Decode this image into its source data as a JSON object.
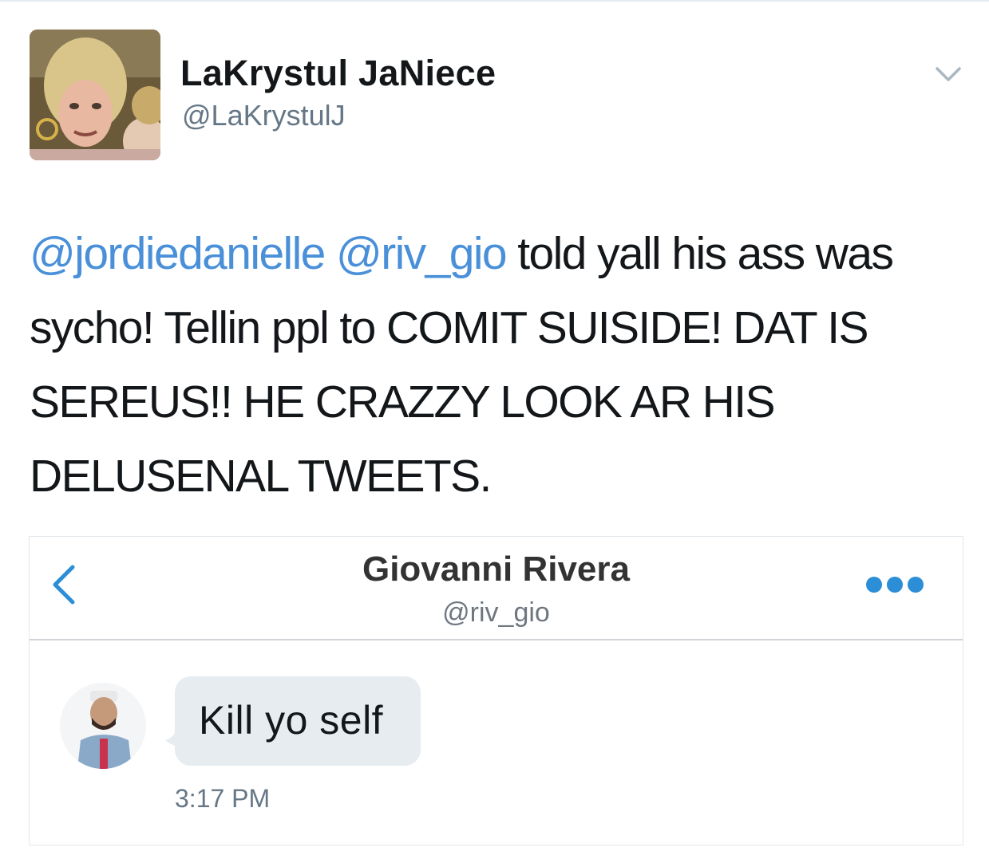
{
  "author": {
    "display_name": "LaKrystul JaNiece",
    "handle": "@LaKrystulJ"
  },
  "tweet": {
    "mention_1": "@jordiedanielle",
    "mention_2": "@riv_gio",
    "body": " told yall his ass was sycho! Tellin ppl to COMIT SUISIDE! DAT IS SEREUS!! HE CRAZZY LOOK AR HIS DELUSENAL TWEETS."
  },
  "embedded_dm": {
    "contact_name": "Giovanni Rivera",
    "contact_handle": "@riv_gio",
    "message": "Kill yo self",
    "time": "3:17 PM"
  },
  "icons": {
    "caret": "chevron-down-icon",
    "back": "chevron-left-icon",
    "more": "more-dots-icon"
  },
  "colors": {
    "mention": "#4a90d9",
    "back_chevron": "#2b8ed6",
    "more_dots": "#2b8ed6",
    "secondary_text": "#657786",
    "bubble": "#e6ecf0"
  }
}
